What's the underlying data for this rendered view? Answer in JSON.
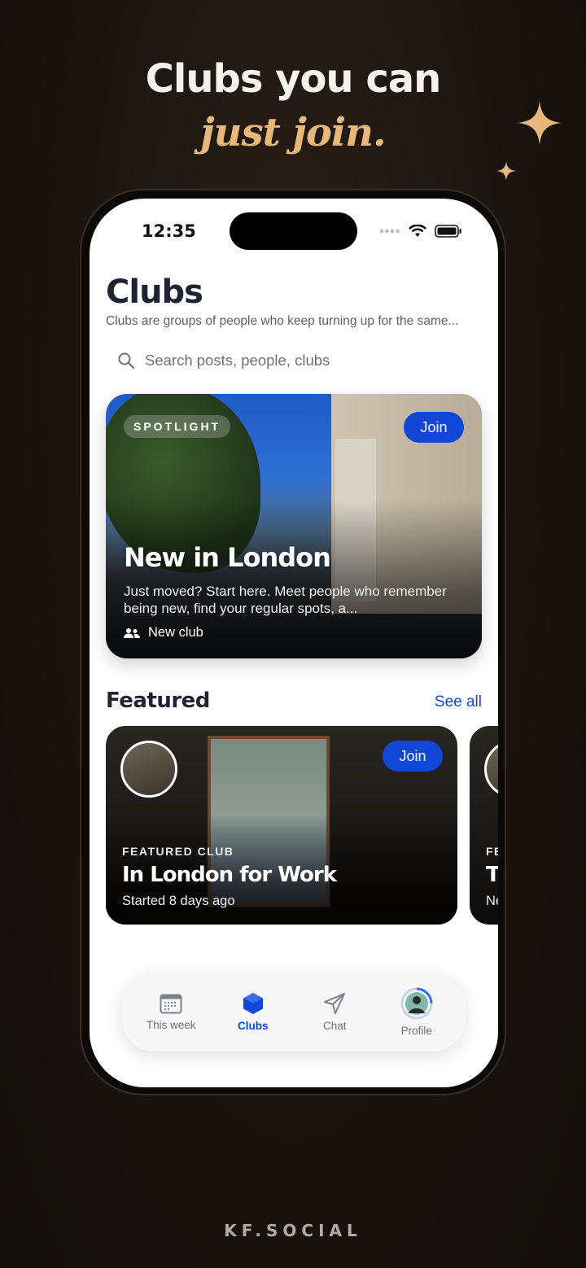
{
  "headline": {
    "line1": "Clubs you can",
    "line2": "just join."
  },
  "brand_footer": "KF.SOCIAL",
  "status_bar": {
    "time": "12:35"
  },
  "page": {
    "title": "Clubs",
    "subtitle": "Clubs are groups of people who keep turning up for the same...",
    "search_placeholder": "Search posts, people, clubs"
  },
  "spotlight": {
    "tag": "SPOTLIGHT",
    "join_label": "Join",
    "title": "New in London",
    "description": "Just moved? Start here. Meet people who remember being new, find your regular spots, a...",
    "meta": "New club"
  },
  "featured": {
    "section_title": "Featured",
    "see_all": "See all",
    "cards": [
      {
        "kicker": "FEATURED CLUB",
        "title": "In London for Work",
        "subtitle": "Started 8 days ago",
        "join_label": "Join"
      },
      {
        "kicker": "FE",
        "title": "T",
        "subtitle": "Ne"
      }
    ]
  },
  "tabbar": {
    "items": [
      {
        "label": "This week",
        "icon": "calendar-icon",
        "active": false
      },
      {
        "label": "Clubs",
        "icon": "cube-icon",
        "active": true
      },
      {
        "label": "Chat",
        "icon": "send-icon",
        "active": false
      },
      {
        "label": "Profile",
        "icon": "avatar-icon",
        "active": false
      }
    ]
  },
  "colors": {
    "accent": "#1147d6",
    "headline_gold": "#e9b77a",
    "background": "#1a1410"
  }
}
